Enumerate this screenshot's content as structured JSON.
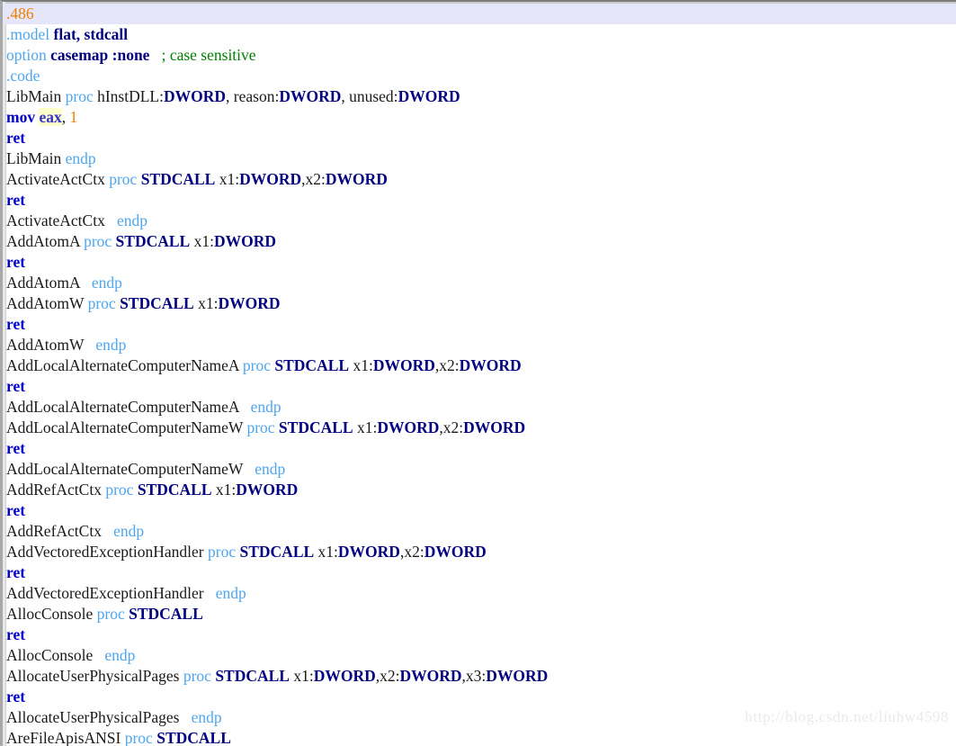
{
  "editor": {
    "highlight_line_bg": "#E6E6FA",
    "register_highlight_bg": "#FFFFCC",
    "background": "#FFFFFF",
    "watermark": "http://blog.csdn.net/liuhw4598"
  },
  "lines": [
    {
      "highlighted": true,
      "tokens": [
        {
          "text": ".486",
          "kind": "directive"
        }
      ]
    },
    {
      "highlighted": false,
      "tokens": [
        {
          "text": ".model",
          "kind": "dirname"
        },
        {
          "text": " ",
          "kind": "plain"
        },
        {
          "text": "flat, stdcall",
          "kind": "bold"
        }
      ]
    },
    {
      "highlighted": false,
      "tokens": [
        {
          "text": "option",
          "kind": "kw"
        },
        {
          "text": " ",
          "kind": "plain"
        },
        {
          "text": "casemap :none",
          "kind": "bold"
        },
        {
          "text": "   ",
          "kind": "plain"
        },
        {
          "text": "; case sensitive",
          "kind": "comment"
        }
      ]
    },
    {
      "highlighted": false,
      "tokens": [
        {
          "text": ".code",
          "kind": "dirname"
        }
      ]
    },
    {
      "highlighted": false,
      "tokens": [
        {
          "text": "LibMain ",
          "kind": "plain"
        },
        {
          "text": "proc",
          "kind": "kw"
        },
        {
          "text": " hInstDLL:",
          "kind": "plain"
        },
        {
          "text": "DWORD",
          "kind": "type"
        },
        {
          "text": ", reason:",
          "kind": "plain"
        },
        {
          "text": "DWORD",
          "kind": "type"
        },
        {
          "text": ", unused:",
          "kind": "plain"
        },
        {
          "text": "DWORD",
          "kind": "type"
        }
      ]
    },
    {
      "highlighted": false,
      "tokens": [
        {
          "text": "mov",
          "kind": "instr"
        },
        {
          "text": " ",
          "kind": "plain"
        },
        {
          "text": "eax",
          "kind": "reg"
        },
        {
          "text": ", ",
          "kind": "plain"
        },
        {
          "text": "1",
          "kind": "num"
        }
      ]
    },
    {
      "highlighted": false,
      "tokens": [
        {
          "text": "ret",
          "kind": "instr"
        }
      ]
    },
    {
      "highlighted": false,
      "tokens": [
        {
          "text": "LibMain ",
          "kind": "plain"
        },
        {
          "text": "endp",
          "kind": "kw"
        }
      ]
    },
    {
      "highlighted": false,
      "tokens": [
        {
          "text": "ActivateActCtx ",
          "kind": "plain"
        },
        {
          "text": "proc",
          "kind": "kw"
        },
        {
          "text": " ",
          "kind": "plain"
        },
        {
          "text": "STDCALL",
          "kind": "bold"
        },
        {
          "text": " x1:",
          "kind": "plain"
        },
        {
          "text": "DWORD",
          "kind": "type"
        },
        {
          "text": ",x2:",
          "kind": "plain"
        },
        {
          "text": "DWORD",
          "kind": "type"
        }
      ]
    },
    {
      "highlighted": false,
      "tokens": [
        {
          "text": "ret",
          "kind": "instr"
        }
      ]
    },
    {
      "highlighted": false,
      "tokens": [
        {
          "text": "ActivateActCtx   ",
          "kind": "plain"
        },
        {
          "text": "endp",
          "kind": "kw"
        }
      ]
    },
    {
      "highlighted": false,
      "tokens": [
        {
          "text": "AddAtomA ",
          "kind": "plain"
        },
        {
          "text": "proc",
          "kind": "kw"
        },
        {
          "text": " ",
          "kind": "plain"
        },
        {
          "text": "STDCALL",
          "kind": "bold"
        },
        {
          "text": " x1:",
          "kind": "plain"
        },
        {
          "text": "DWORD",
          "kind": "type"
        }
      ]
    },
    {
      "highlighted": false,
      "tokens": [
        {
          "text": "ret",
          "kind": "instr"
        }
      ]
    },
    {
      "highlighted": false,
      "tokens": [
        {
          "text": "AddAtomA   ",
          "kind": "plain"
        },
        {
          "text": "endp",
          "kind": "kw"
        }
      ]
    },
    {
      "highlighted": false,
      "tokens": [
        {
          "text": "AddAtomW ",
          "kind": "plain"
        },
        {
          "text": "proc",
          "kind": "kw"
        },
        {
          "text": " ",
          "kind": "plain"
        },
        {
          "text": "STDCALL",
          "kind": "bold"
        },
        {
          "text": " x1:",
          "kind": "plain"
        },
        {
          "text": "DWORD",
          "kind": "type"
        }
      ]
    },
    {
      "highlighted": false,
      "tokens": [
        {
          "text": "ret",
          "kind": "instr"
        }
      ]
    },
    {
      "highlighted": false,
      "tokens": [
        {
          "text": "AddAtomW   ",
          "kind": "plain"
        },
        {
          "text": "endp",
          "kind": "kw"
        }
      ]
    },
    {
      "highlighted": false,
      "tokens": [
        {
          "text": "AddLocalAlternateComputerNameA ",
          "kind": "plain"
        },
        {
          "text": "proc",
          "kind": "kw"
        },
        {
          "text": " ",
          "kind": "plain"
        },
        {
          "text": "STDCALL",
          "kind": "bold"
        },
        {
          "text": " x1:",
          "kind": "plain"
        },
        {
          "text": "DWORD",
          "kind": "type"
        },
        {
          "text": ",x2:",
          "kind": "plain"
        },
        {
          "text": "DWORD",
          "kind": "type"
        }
      ]
    },
    {
      "highlighted": false,
      "tokens": [
        {
          "text": "ret",
          "kind": "instr"
        }
      ]
    },
    {
      "highlighted": false,
      "tokens": [
        {
          "text": "AddLocalAlternateComputerNameA   ",
          "kind": "plain"
        },
        {
          "text": "endp",
          "kind": "kw"
        }
      ]
    },
    {
      "highlighted": false,
      "tokens": [
        {
          "text": "AddLocalAlternateComputerNameW ",
          "kind": "plain"
        },
        {
          "text": "proc",
          "kind": "kw"
        },
        {
          "text": " ",
          "kind": "plain"
        },
        {
          "text": "STDCALL",
          "kind": "bold"
        },
        {
          "text": " x1:",
          "kind": "plain"
        },
        {
          "text": "DWORD",
          "kind": "type"
        },
        {
          "text": ",x2:",
          "kind": "plain"
        },
        {
          "text": "DWORD",
          "kind": "type"
        }
      ]
    },
    {
      "highlighted": false,
      "tokens": [
        {
          "text": "ret",
          "kind": "instr"
        }
      ]
    },
    {
      "highlighted": false,
      "tokens": [
        {
          "text": "AddLocalAlternateComputerNameW   ",
          "kind": "plain"
        },
        {
          "text": "endp",
          "kind": "kw"
        }
      ]
    },
    {
      "highlighted": false,
      "tokens": [
        {
          "text": "AddRefActCtx ",
          "kind": "plain"
        },
        {
          "text": "proc",
          "kind": "kw"
        },
        {
          "text": " ",
          "kind": "plain"
        },
        {
          "text": "STDCALL",
          "kind": "bold"
        },
        {
          "text": " x1:",
          "kind": "plain"
        },
        {
          "text": "DWORD",
          "kind": "type"
        }
      ]
    },
    {
      "highlighted": false,
      "tokens": [
        {
          "text": "ret",
          "kind": "instr"
        }
      ]
    },
    {
      "highlighted": false,
      "tokens": [
        {
          "text": "AddRefActCtx   ",
          "kind": "plain"
        },
        {
          "text": "endp",
          "kind": "kw"
        }
      ]
    },
    {
      "highlighted": false,
      "tokens": [
        {
          "text": "AddVectoredExceptionHandler ",
          "kind": "plain"
        },
        {
          "text": "proc",
          "kind": "kw"
        },
        {
          "text": " ",
          "kind": "plain"
        },
        {
          "text": "STDCALL",
          "kind": "bold"
        },
        {
          "text": " x1:",
          "kind": "plain"
        },
        {
          "text": "DWORD",
          "kind": "type"
        },
        {
          "text": ",x2:",
          "kind": "plain"
        },
        {
          "text": "DWORD",
          "kind": "type"
        }
      ]
    },
    {
      "highlighted": false,
      "tokens": [
        {
          "text": "ret",
          "kind": "instr"
        }
      ]
    },
    {
      "highlighted": false,
      "tokens": [
        {
          "text": "AddVectoredExceptionHandler   ",
          "kind": "plain"
        },
        {
          "text": "endp",
          "kind": "kw"
        }
      ]
    },
    {
      "highlighted": false,
      "tokens": [
        {
          "text": "AllocConsole ",
          "kind": "plain"
        },
        {
          "text": "proc",
          "kind": "kw"
        },
        {
          "text": " ",
          "kind": "plain"
        },
        {
          "text": "STDCALL",
          "kind": "bold"
        }
      ]
    },
    {
      "highlighted": false,
      "tokens": [
        {
          "text": "ret",
          "kind": "instr"
        }
      ]
    },
    {
      "highlighted": false,
      "tokens": [
        {
          "text": "AllocConsole   ",
          "kind": "plain"
        },
        {
          "text": "endp",
          "kind": "kw"
        }
      ]
    },
    {
      "highlighted": false,
      "tokens": [
        {
          "text": "AllocateUserPhysicalPages ",
          "kind": "plain"
        },
        {
          "text": "proc",
          "kind": "kw"
        },
        {
          "text": " ",
          "kind": "plain"
        },
        {
          "text": "STDCALL",
          "kind": "bold"
        },
        {
          "text": " x1:",
          "kind": "plain"
        },
        {
          "text": "DWORD",
          "kind": "type"
        },
        {
          "text": ",x2:",
          "kind": "plain"
        },
        {
          "text": "DWORD",
          "kind": "type"
        },
        {
          "text": ",x3:",
          "kind": "plain"
        },
        {
          "text": "DWORD",
          "kind": "type"
        }
      ]
    },
    {
      "highlighted": false,
      "tokens": [
        {
          "text": "ret",
          "kind": "instr"
        }
      ]
    },
    {
      "highlighted": false,
      "tokens": [
        {
          "text": "AllocateUserPhysicalPages   ",
          "kind": "plain"
        },
        {
          "text": "endp",
          "kind": "kw"
        }
      ]
    },
    {
      "highlighted": false,
      "tokens": [
        {
          "text": "AreFileApisANSI ",
          "kind": "plain"
        },
        {
          "text": "proc",
          "kind": "kw"
        },
        {
          "text": " ",
          "kind": "plain"
        },
        {
          "text": "STDCALL",
          "kind": "bold"
        }
      ]
    }
  ]
}
